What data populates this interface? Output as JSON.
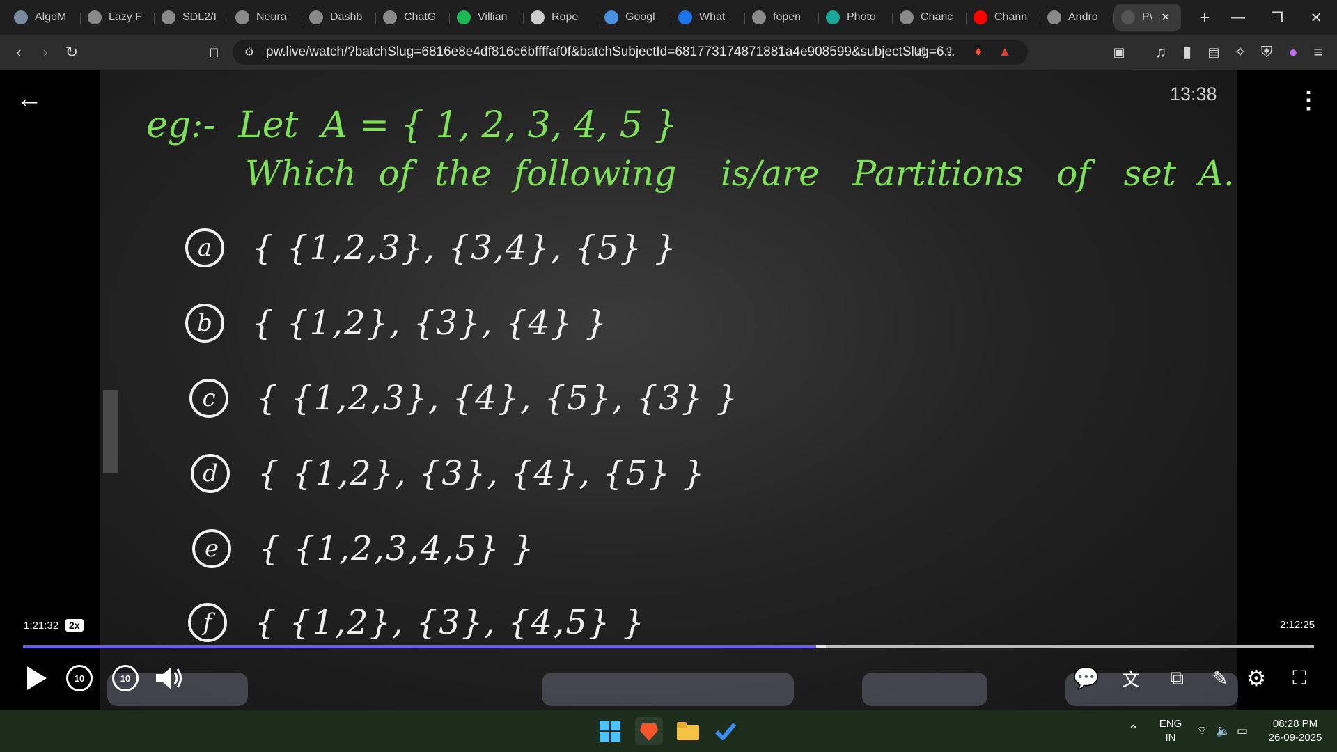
{
  "browser": {
    "tabs": [
      {
        "label": "AlgoM",
        "icon": "algo-icon",
        "color": "#7a8aa0"
      },
      {
        "label": "Lazy F",
        "icon": "openai-icon",
        "color": "#8a8a8a"
      },
      {
        "label": "SDL2/I",
        "icon": "openai-icon",
        "color": "#8a8a8a"
      },
      {
        "label": "Neura",
        "icon": "openai-icon",
        "color": "#8a8a8a"
      },
      {
        "label": "Dashb",
        "icon": "openai-icon",
        "color": "#8a8a8a"
      },
      {
        "label": "ChatG",
        "icon": "openai-icon",
        "color": "#8a8a8a"
      },
      {
        "label": "Villian",
        "icon": "spotify-icon",
        "color": "#1db954"
      },
      {
        "label": "Rope",
        "icon": "wordpress-icon",
        "color": "#cccccc"
      },
      {
        "label": "Googl",
        "icon": "gemini-icon",
        "color": "#4a90e2"
      },
      {
        "label": "What",
        "icon": "orm-icon",
        "color": "#1a73e8"
      },
      {
        "label": "fopen",
        "icon": "openai-icon",
        "color": "#8a8a8a"
      },
      {
        "label": "Photo",
        "icon": "photo-icon",
        "color": "#19a79a"
      },
      {
        "label": "Chanc",
        "icon": "openai-icon",
        "color": "#8a8a8a"
      },
      {
        "label": "Chann",
        "icon": "youtube-icon",
        "color": "#ff0000"
      },
      {
        "label": "Andro",
        "icon": "openai-icon",
        "color": "#8a8a8a"
      },
      {
        "label": "P\\",
        "icon": "pw-icon",
        "color": "#555555",
        "active": true
      }
    ],
    "address": "pw.live/watch/?batchSlug=6816e8e4df816c6bffffaf0f&batchSubjectId=681773174871881a4e908599&subjectSlug=6..."
  },
  "board": {
    "line1": "eg:-  Let  A = { 1, 2, 3, 4, 5 }",
    "line2": "Which  of  the  following    is/are   Partitions   of   set  A.",
    "options": [
      {
        "letter": "a",
        "set": "{ {1,2,3}, {3,4}, {5} }"
      },
      {
        "letter": "b",
        "set": "{ {1,2}, {3}, {4} }"
      },
      {
        "letter": "c",
        "set": "{ {1,2,3}, {4}, {5}, {3} }"
      },
      {
        "letter": "d",
        "set": "{ {1,2}, {3}, {4}, {5} }"
      },
      {
        "letter": "e",
        "set": "{ {1,2,3,4,5} }"
      },
      {
        "letter": "f",
        "set": "{ {1,2}, {3}, {4,5} }"
      }
    ]
  },
  "player": {
    "overlay_clock": "13:38",
    "current_time": "1:21:32",
    "speed": "2x",
    "total_time": "2:12:25",
    "progress_fraction": 0.6146,
    "skip_back": "10",
    "skip_forward": "10"
  },
  "taskbar": {
    "language_top": "ENG",
    "language_bottom": "IN",
    "time": "08:28 PM",
    "date": "26-09-2025"
  }
}
